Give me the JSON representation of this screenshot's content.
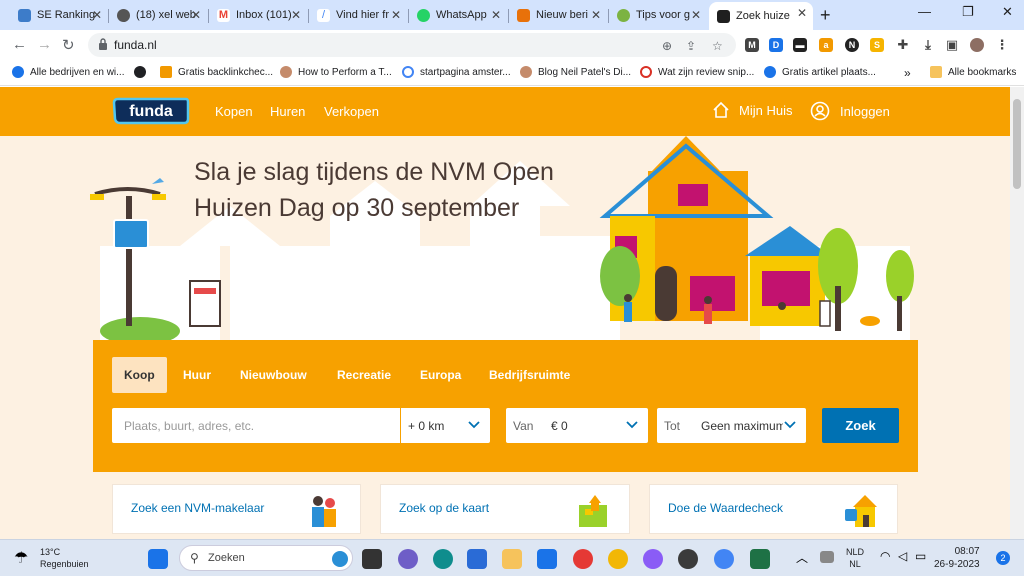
{
  "browser": {
    "tabs": [
      {
        "title": "SE Ranking",
        "color": "#3d7cc9"
      },
      {
        "title": "(18) xel web",
        "color": "#555555"
      },
      {
        "title": "Inbox (101)",
        "color": "#ea4335"
      },
      {
        "title": "Vind hier fr",
        "color": "#4285f4"
      },
      {
        "title": "WhatsApp",
        "color": "#25d366"
      },
      {
        "title": "Nieuw beri",
        "color": "#e8710a"
      },
      {
        "title": "Tips voor g",
        "color": "#7cb342"
      },
      {
        "title": "Zoek huize",
        "color": "#e8eaed"
      }
    ],
    "url": "funda.nl",
    "bookmarks": [
      {
        "label": "Alle bedrijven en wi...",
        "color": "#1a73e8"
      },
      {
        "label": "",
        "color": "#202124"
      },
      {
        "label": "Gratis backlinkchec...",
        "color": "#f29900"
      },
      {
        "label": "How to Perform a T...",
        "color": "#c58b6b"
      },
      {
        "label": "startpagina amster...",
        "color": "#4285f4"
      },
      {
        "label": "Blog Neil Patel's Di...",
        "color": "#c58b6b"
      },
      {
        "label": "Wat zijn review snip...",
        "color": "#d93025"
      },
      {
        "label": "Gratis artikel plaats...",
        "color": "#1a73e8"
      }
    ],
    "bookmarks_more": "»",
    "all_bookmarks": "Alle bookmarks"
  },
  "site": {
    "logo": "funda",
    "nav": [
      "Kopen",
      "Huren",
      "Verkopen"
    ],
    "mijn_huis": "Mijn Huis",
    "login": "Inloggen",
    "hero_title": "Sla je slag tijdens de NVM Open Huizen Dag op 30 september",
    "search_tabs": [
      "Koop",
      "Huur",
      "Nieuwbouw",
      "Recreatie",
      "Europa",
      "Bedrijfsruimte"
    ],
    "search_placeholder": "Plaats, buurt, adres, etc.",
    "radius": "+ 0 km",
    "van_label": "Van",
    "van_value": "€ 0",
    "tot_label": "Tot",
    "tot_value": "Geen maximum",
    "search_button": "Zoek",
    "cards": [
      "Zoek een NVM-makelaar",
      "Zoek op de kaart",
      "Doe de Waardecheck"
    ]
  },
  "colors": {
    "brand": "#f7a100",
    "link": "#0071b3"
  },
  "taskbar": {
    "temp": "13°C",
    "weather": "Regenbuien",
    "search": "Zoeken",
    "lang1": "NLD",
    "lang2": "NL",
    "time": "08:07",
    "date": "26-9-2023",
    "notif": "2"
  }
}
